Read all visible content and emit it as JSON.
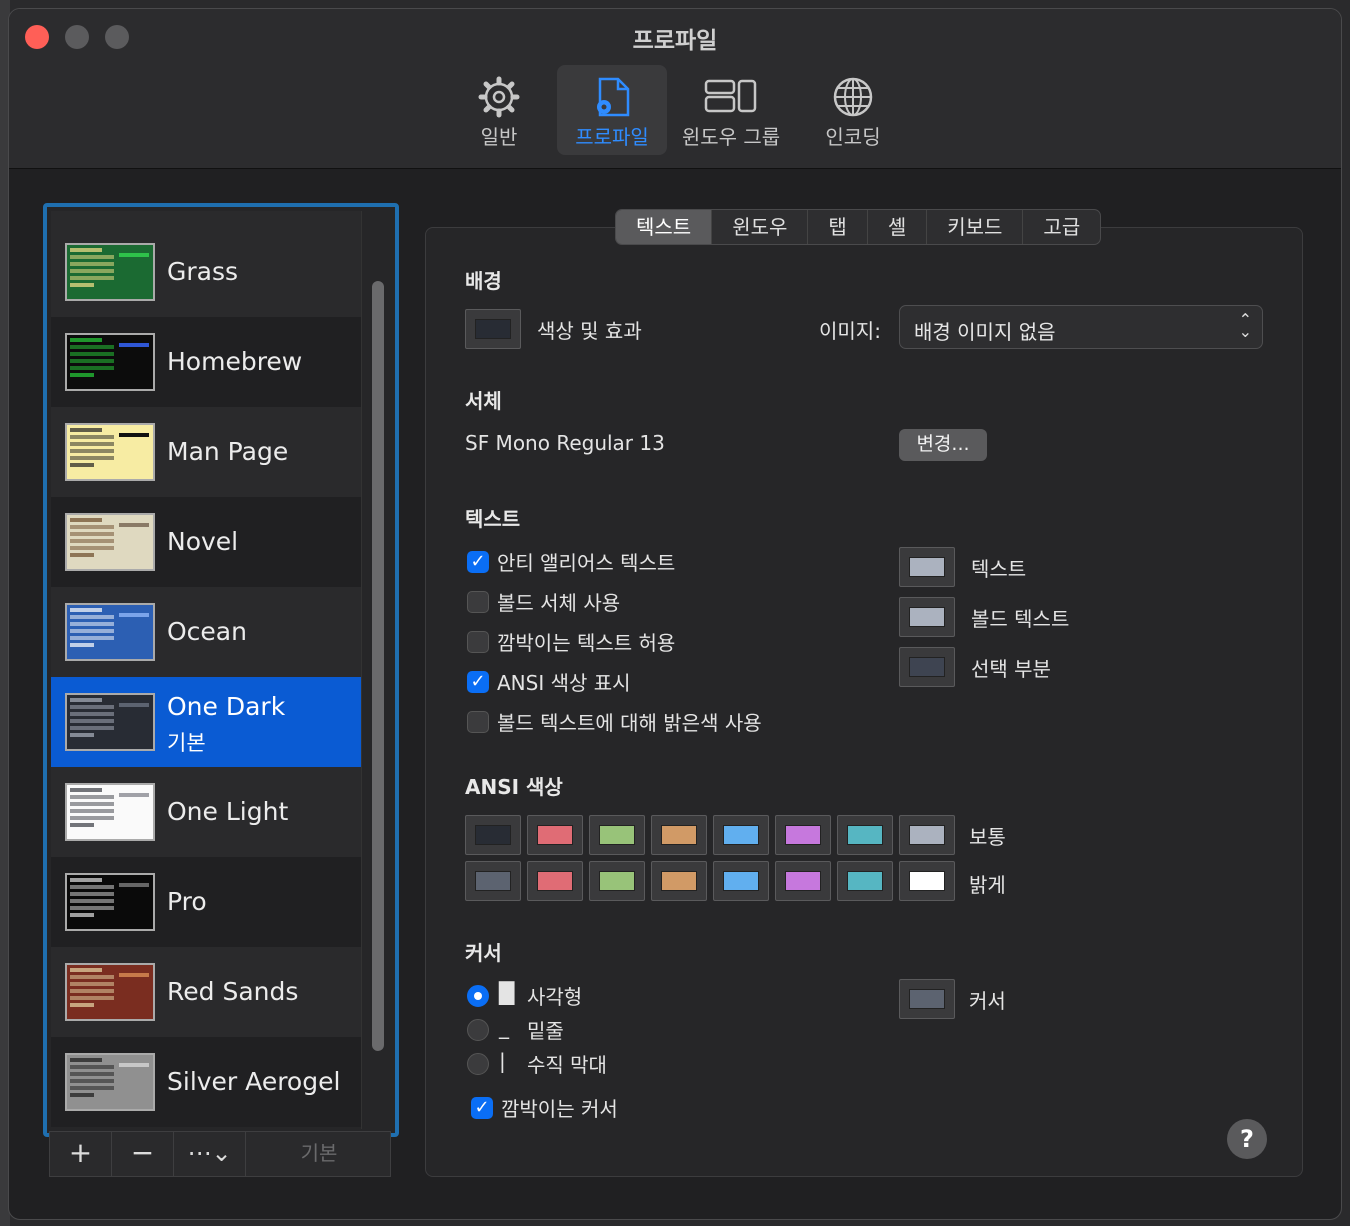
{
  "window": {
    "title": "프로파일"
  },
  "toolbar": {
    "items": [
      {
        "label": "일반",
        "icon": "gear-icon"
      },
      {
        "label": "프로파일",
        "icon": "profile-doc-icon"
      },
      {
        "label": "윈도우 그룹",
        "icon": "window-group-icon"
      },
      {
        "label": "인코딩",
        "icon": "globe-icon"
      }
    ],
    "active": "프로파일"
  },
  "profiles": [
    {
      "name": "Grass",
      "bg": "#1b6a32",
      "fg": "#f7e38a",
      "hd": "#2ec24a"
    },
    {
      "name": "Homebrew",
      "bg": "#0c0c0c",
      "fg": "#28d23a",
      "hd": "#2f57d6"
    },
    {
      "name": "Man Page",
      "bg": "#f7eca3",
      "fg": "#222222",
      "hd": "#111111"
    },
    {
      "name": "Novel",
      "bg": "#dfd9c0",
      "fg": "#6b4a2a",
      "hd": "#8a7a66"
    },
    {
      "name": "Ocean",
      "bg": "#2c5fb3",
      "fg": "#ffffff",
      "hd": "#7ba4ea"
    },
    {
      "name": "One Dark",
      "sub": "기본",
      "bg": "#282c34",
      "fg": "#abb2bf",
      "hd": "#5c6370",
      "selected": true
    },
    {
      "name": "One Light",
      "bg": "#fafafa",
      "fg": "#383a42",
      "hd": "#a0a1a7"
    },
    {
      "name": "Pro",
      "bg": "#0a0a0a",
      "fg": "#e0e0e0",
      "hd": "#666666"
    },
    {
      "name": "Red Sands",
      "bg": "#7a2d20",
      "fg": "#e8d9a8",
      "hd": "#c77a4a"
    },
    {
      "name": "Silver Aerogel",
      "bg": "#909090",
      "fg": "#1a1a1a",
      "hd": "#c8c8c8"
    }
  ],
  "list_buttons": {
    "add": "+",
    "remove": "−",
    "more": "⋯⌄",
    "default": "기본"
  },
  "tabs": [
    "텍스트",
    "윈도우",
    "탭",
    "셸",
    "키보드",
    "고급"
  ],
  "active_tab": "텍스트",
  "background": {
    "heading": "배경",
    "color_label": "색상 및 효과",
    "image_label": "이미지:",
    "image_value": "배경 이미지 없음",
    "swatch": "#282c34"
  },
  "font": {
    "heading": "서체",
    "value": "SF Mono Regular 13",
    "change_button": "변경..."
  },
  "text": {
    "heading": "텍스트",
    "options": [
      {
        "label": "안티 앨리어스 텍스트",
        "checked": true
      },
      {
        "label": "볼드 서체 사용",
        "checked": false
      },
      {
        "label": "깜박이는 텍스트 허용",
        "checked": false
      },
      {
        "label": "ANSI 색상 표시",
        "checked": true
      },
      {
        "label": "볼드 텍스트에 대해 밝은색 사용",
        "checked": false
      }
    ],
    "colors": [
      {
        "label": "텍스트",
        "color": "#abb2bf"
      },
      {
        "label": "볼드 텍스트",
        "color": "#abb2bf"
      },
      {
        "label": "선택 부분",
        "color": "#3e4451"
      }
    ]
  },
  "ansi": {
    "heading": "ANSI 색상",
    "normal_label": "보통",
    "bright_label": "밝게",
    "normal": [
      "#282c34",
      "#e06c75",
      "#98c379",
      "#d19a66",
      "#61afef",
      "#c678dd",
      "#56b6c2",
      "#abb2bf"
    ],
    "bright": [
      "#5c6370",
      "#e06c75",
      "#98c379",
      "#d19a66",
      "#61afef",
      "#c678dd",
      "#56b6c2",
      "#ffffff"
    ]
  },
  "cursor": {
    "heading": "커서",
    "options": [
      {
        "glyph": "█",
        "label": "사각형",
        "selected": true
      },
      {
        "glyph": "_",
        "label": "밑줄",
        "selected": false
      },
      {
        "glyph": "|",
        "label": "수직 막대",
        "selected": false
      }
    ],
    "blink_label": "깜박이는 커서",
    "blink_checked": true,
    "color_label": "커서",
    "color": "#5c6370"
  },
  "help": "?"
}
